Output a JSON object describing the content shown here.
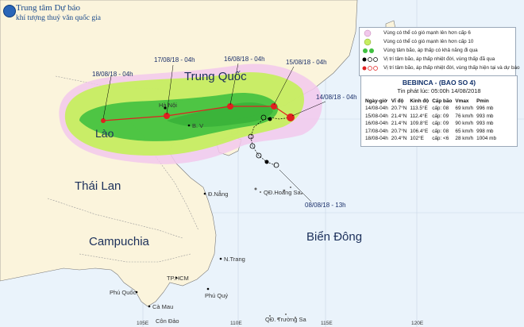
{
  "header": {
    "line1": "Trung tâm Dự báo",
    "line2": "khí tượng thuỷ văn quốc gia"
  },
  "countries": {
    "china": "Trung Quốc",
    "laos": "Lào",
    "thailand": "Thái Lan",
    "cambodia": "Campuchia",
    "east_sea": "Biển Đông"
  },
  "places": {
    "hanoi": "Hà Nội",
    "bv": "B. V",
    "danang": "Đ.Nẵng",
    "hoangsa": "QĐ.Hoàng Sa",
    "nhatrang": "N.Trang",
    "hcm": "TP.HCM",
    "phuquoc": "Phú Quốc",
    "camau": "Cà Mau",
    "phuquy": "Phú Quý",
    "condao": "Côn Đảo",
    "truongsa": "QĐ. Trường Sa"
  },
  "track_dates": {
    "d18": "18/08/18 - 04h",
    "d17": "17/08/18 - 04h",
    "d16": "16/08/18 - 04h",
    "d15": "15/08/18 - 04h",
    "d14": "14/08/18 - 04h",
    "d08": "08/08/18 - 13h"
  },
  "axis_labels": [
    "105E",
    "110E",
    "115E",
    "120E"
  ],
  "legend": {
    "items": [
      {
        "text": "Vùng có thể có gió mạnh lên hơn cấp 6",
        "swatch": "#f2c8ec"
      },
      {
        "text": "Vùng có thể có gió mạnh lên hơn cấp 10",
        "swatch": "#c6ee60"
      },
      {
        "text": "Vùng tâm bão, áp thấp có khả năng đi qua",
        "swatch": "#40c040"
      },
      {
        "text": "Vị trí tâm bão, áp thấp nhiệt đới, vùng thấp đã qua",
        "swatch": "#000000"
      },
      {
        "text": "Vị trí tâm bão, áp thấp nhiệt đới, vùng thấp hiện tại và dự báo",
        "swatch": "#e02020"
      }
    ]
  },
  "info": {
    "title": "BEBINCA - (BAO SO 4)",
    "subtitle": "Tin phát lúc: 05:00h 14/08/2018",
    "headers": [
      "Ngày-giờ",
      "Vĩ độ",
      "Kinh độ",
      "Cấp bão",
      "Vmax",
      "Pmin"
    ],
    "rows": [
      [
        "14/08-04h",
        "20.7°N",
        "113.5°E",
        "cấp: 08",
        "69 km/h",
        "996 mb"
      ],
      [
        "15/08-04h",
        "21.4°N",
        "112.4°E",
        "cấp: 09",
        "76 km/h",
        "993 mb"
      ],
      [
        "16/08-04h",
        "21.4°N",
        "109.8°E",
        "cấp: 09",
        "90 km/h",
        "993 mb"
      ],
      [
        "17/08-04h",
        "20.7°N",
        "106.4°E",
        "cấp: 08",
        "65 km/h",
        "998 mb"
      ],
      [
        "18/08-04h",
        "20.4°N",
        "102°E",
        "cấp: <6",
        "28 km/h",
        "1004 mb"
      ]
    ]
  },
  "colors": {
    "sea": "#eaf3fb",
    "land": "#fbf4dc",
    "zone6": "#f2c8ec",
    "zone10": "#c6ee60",
    "storm": "#e02020",
    "past": "#000000"
  }
}
